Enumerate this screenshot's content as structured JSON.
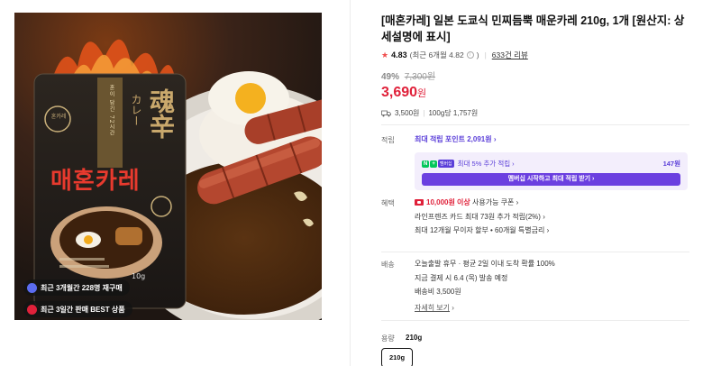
{
  "product": {
    "title": "[매혼카레] 일본 도쿄식 민찌듬뿍 매운카레 210g, 1개 [원산지: 상세설명에 표시]",
    "image_text": {
      "brand_seal": "혼카레",
      "kanji_line1": "魂辛",
      "kanji_line2": "カレー",
      "vertical_label": "혼이 담긴 72시간",
      "name": "매혼카레",
      "weight": "10g",
      "badge_1": "최근 3개월간 228명 재구매",
      "badge_2": "최근 3일간 판매 BEST 상품"
    }
  },
  "rating": {
    "score": "4.83",
    "recent": "(최근 6개월 4.82",
    "recent_close": ")",
    "reviews": "633건 리뷰"
  },
  "pricing": {
    "discount_rate": "49%",
    "original_price": "7,300원",
    "price": "3,690",
    "price_unit": "원"
  },
  "shipping_summary": {
    "fee": "3,500원",
    "unit_price": "100g당 1,757원"
  },
  "points": {
    "label": "적립",
    "max_points_text": "최대 적립 포인트",
    "max_points_value": "2,091원",
    "membership_text": "최대 5% 추가 적립",
    "membership_amount": "147원",
    "np_logo": "N",
    "plus_logo": "멤버십",
    "membership_button": "멤버십 시작하고 최대 적립 받기"
  },
  "benefits": {
    "label": "혜택",
    "coupon_amount": "10,000원 이상",
    "coupon_text": "사용가능 쿠폰",
    "card_text": "라인프렌즈 카드 최대 73원 추가 적립(2%)",
    "installment_text": "최대 12개월 무이자 할부 • 60개월 특별금리"
  },
  "delivery": {
    "label": "배송",
    "line1": "오늘출발 휴무 · 평균 2일 이내 도착 확률 100%",
    "line2": "지금 결제 시 6.4 (목) 발송 예정",
    "line3": "배송비 3,500원",
    "detail_link": "자세히 보기"
  },
  "option": {
    "label": "용량",
    "selected": "210g",
    "choice": "210g"
  },
  "colors": {
    "price_red": "#e0213a",
    "membership_purple": "#5b3fd9",
    "naverpay_green": "#03c75a"
  }
}
